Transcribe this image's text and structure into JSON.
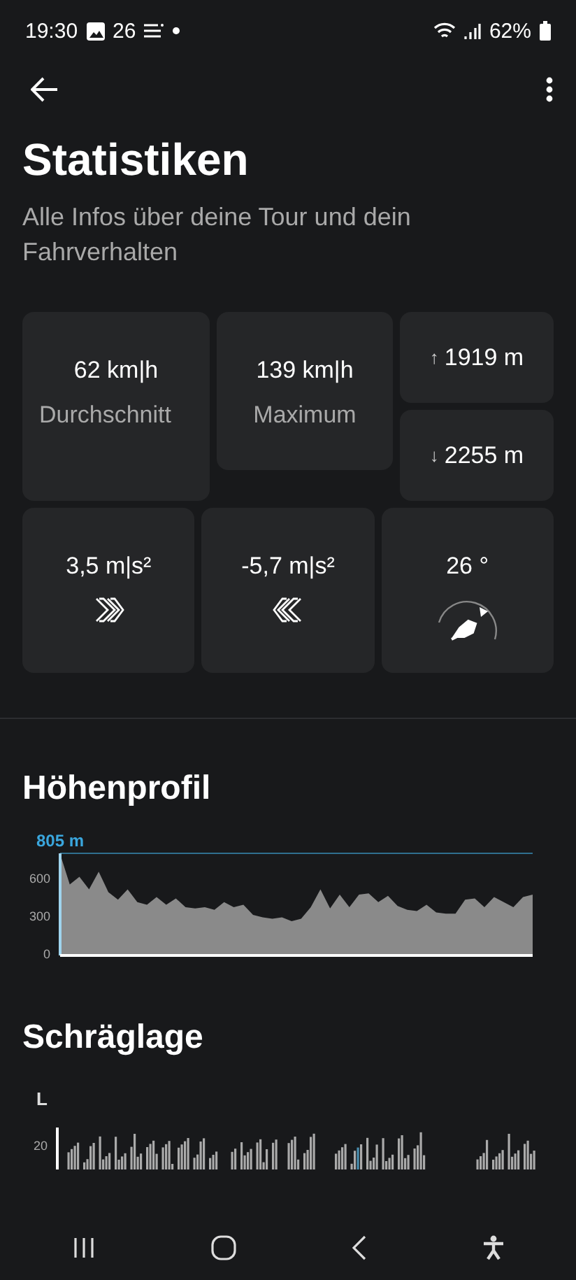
{
  "status_bar": {
    "time": "19:30",
    "temperature": "26",
    "battery": "62%"
  },
  "header": {
    "title": "Statistiken",
    "subtitle": "Alle Infos über deine Tour und dein Fahrverhalten"
  },
  "tiles_top": [
    {
      "kind": "speed",
      "value": "62 km|h",
      "label": "Durchschnitt"
    },
    {
      "kind": "speed",
      "value": "139 km|h",
      "label": "Maximum"
    },
    {
      "kind": "climb",
      "arrow": "↑",
      "value": "1919 m"
    },
    {
      "kind": "climb",
      "arrow": "↓",
      "value": "2255 m"
    }
  ],
  "tiles_bottom": [
    {
      "kind": "accel",
      "value": "3,5 m|s²"
    },
    {
      "kind": "decel",
      "value": "-5,7 m|s²"
    },
    {
      "kind": "angle",
      "value": "26 °"
    }
  ],
  "elevation": {
    "title": "Höhenprofil",
    "max_label": "805 m",
    "chart_data": {
      "type": "area",
      "ylim": [
        0,
        805
      ],
      "yticks": [
        0,
        300,
        600
      ],
      "series": [
        {
          "color": "#8a8a8a",
          "values": [
            800,
            560,
            620,
            520,
            660,
            500,
            440,
            520,
            420,
            400,
            460,
            400,
            450,
            380,
            370,
            380,
            360,
            420,
            380,
            400,
            320,
            300,
            290,
            300,
            270,
            290,
            380,
            520,
            370,
            480,
            380,
            480,
            490,
            420,
            470,
            390,
            360,
            350,
            400,
            340,
            330,
            330,
            440,
            450,
            380,
            460,
            420,
            380,
            460,
            480
          ]
        }
      ]
    }
  },
  "lean": {
    "title": "Schräglage",
    "side_label": "L",
    "tick": "20"
  }
}
